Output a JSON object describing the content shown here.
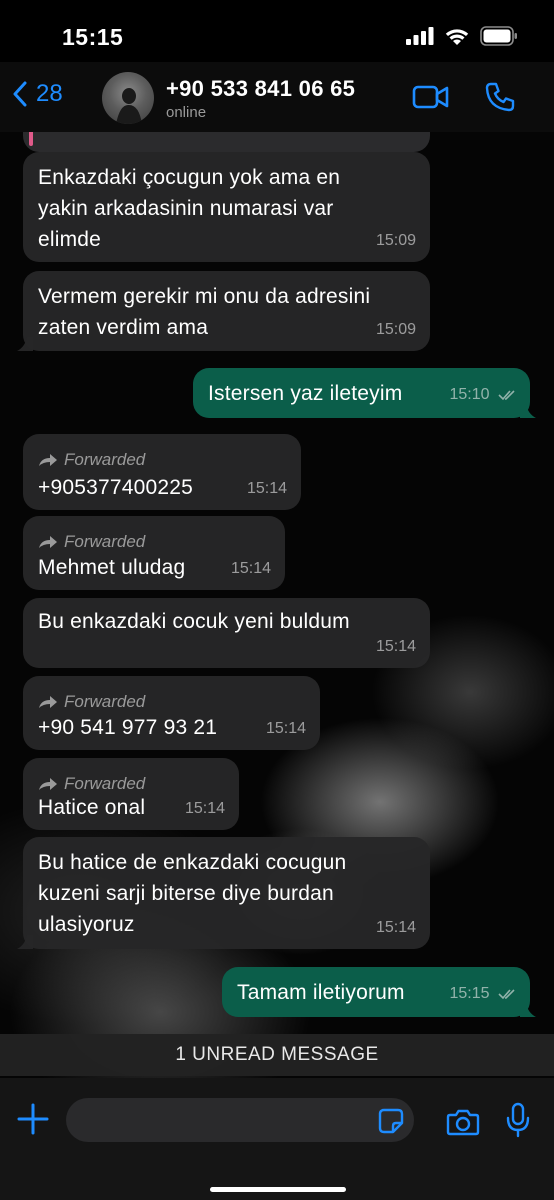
{
  "status_bar": {
    "time": "15:15"
  },
  "header": {
    "back_count": "28",
    "contact_name": "+90 533 841 06 65",
    "contact_status": "online"
  },
  "messages": [
    {
      "direction": "in",
      "text": "Enkazdaki çocugun yok ama en",
      "text2": "yakin arkadasinin numarasi var",
      "text3": "elimde",
      "time": "15:09"
    },
    {
      "direction": "in",
      "text": "Vermem gerekir mi onu da adresini",
      "text2": "zaten verdim ama",
      "time": "15:09"
    },
    {
      "direction": "out",
      "text": "Istersen yaz ileteyim",
      "time": "15:10",
      "status": "read"
    },
    {
      "direction": "in",
      "forwarded": "Forwarded",
      "text": "+905377400225",
      "time": "15:14"
    },
    {
      "direction": "in",
      "forwarded": "Forwarded",
      "text": "Mehmet uludag",
      "time": "15:14"
    },
    {
      "direction": "in",
      "text": "Bu enkazdaki cocuk yeni buldum",
      "time": "15:14"
    },
    {
      "direction": "in",
      "forwarded": "Forwarded",
      "text": "+90 541 977 93 21",
      "time": "15:14"
    },
    {
      "direction": "in",
      "forwarded": "Forwarded",
      "text": "Hatice onal",
      "time": "15:14"
    },
    {
      "direction": "in",
      "text": "Bu hatice de enkazdaki cocugun",
      "text2": "kuzeni sarji biterse diye burdan",
      "text3": "ulasiyoruz",
      "time": "15:14"
    },
    {
      "direction": "out",
      "text": "Tamam iletiyorum",
      "time": "15:15",
      "status": "read"
    }
  ],
  "unread_banner": "1 UNREAD MESSAGE",
  "colors": {
    "accent": "#1e8cff",
    "incoming_bubble": "#262628",
    "outgoing_bubble": "#0b5e4a",
    "background": "#000000"
  },
  "icons": [
    "back-chevron-icon",
    "video-call-icon",
    "phone-call-icon",
    "forward-arrow-icon",
    "double-check-icon",
    "plus-icon",
    "sticker-icon",
    "camera-icon",
    "microphone-icon",
    "signal-icon",
    "wifi-icon",
    "battery-icon"
  ]
}
